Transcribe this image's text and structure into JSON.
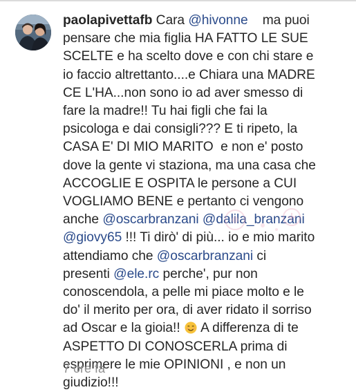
{
  "comment": {
    "username": "paolapivettafb",
    "lines": [
      [
        {
          "t": "Cara "
        },
        {
          "m": "@hivonne"
        },
        {
          "t": "    ma puoi"
        }
      ],
      [
        {
          "t": "pensare che mia figlia HA FATTO LE SUE"
        }
      ],
      [
        {
          "t": "SCELTE e ha scelto dove e con chi stare e"
        }
      ],
      [
        {
          "t": "io faccio altrettanto....e Chiara una MADRE"
        }
      ],
      [
        {
          "t": "CE L'HA...non sono io ad aver smesso di"
        }
      ],
      [
        {
          "t": "fare la madre!! Tu hai figli che fai la"
        }
      ],
      [
        {
          "t": "psicologa e dai consigli??? E ti ripeto, la"
        }
      ],
      [
        {
          "t": "CASA E' DI MIO MARITO  e non e' posto"
        }
      ],
      [
        {
          "t": "dove la gente vi staziona, ma una casa che"
        }
      ],
      [
        {
          "t": "ACCOGLIE E OSPITA le persone a CUI"
        }
      ],
      [
        {
          "t": "VOGLIAMO BENE e pertanto ci vengono"
        }
      ],
      [
        {
          "t": "anche "
        },
        {
          "m": "@oscarbranzani"
        },
        {
          "t": " "
        },
        {
          "m": "@dalila_branzani"
        }
      ],
      [
        {
          "m": "@giovy65"
        },
        {
          "t": " !!! Ti dirò' di più... io e mio marito"
        }
      ],
      [
        {
          "t": "attendiamo che "
        },
        {
          "m": "@oscarbranzani"
        },
        {
          "t": " ci"
        }
      ],
      [
        {
          "t": "presenti "
        },
        {
          "m": "@ele.rc"
        },
        {
          "t": " perche', pur non"
        }
      ],
      [
        {
          "t": "conoscendola, a pelle mi piace molto e le"
        }
      ],
      [
        {
          "t": "do' il merito per ora, di aver ridato il sorriso"
        }
      ],
      [
        {
          "t": "ad Oscar e la gioia!! "
        },
        {
          "e": "smiling-face-emoji"
        },
        {
          "t": " A differenza di te"
        }
      ],
      [
        {
          "t": "ASPETTO DI CONOSCERLA prima di"
        }
      ],
      [
        {
          "t": "esprimere le mie OPINIONI , e non un"
        }
      ],
      [
        {
          "t": "giudizio!!!"
        }
      ]
    ],
    "timestamp": "7 ore fa"
  },
  "colors": {
    "text": "#262626",
    "mention": "#2b4b8b",
    "meta": "#8e8e8e",
    "background": "#ffffff"
  }
}
